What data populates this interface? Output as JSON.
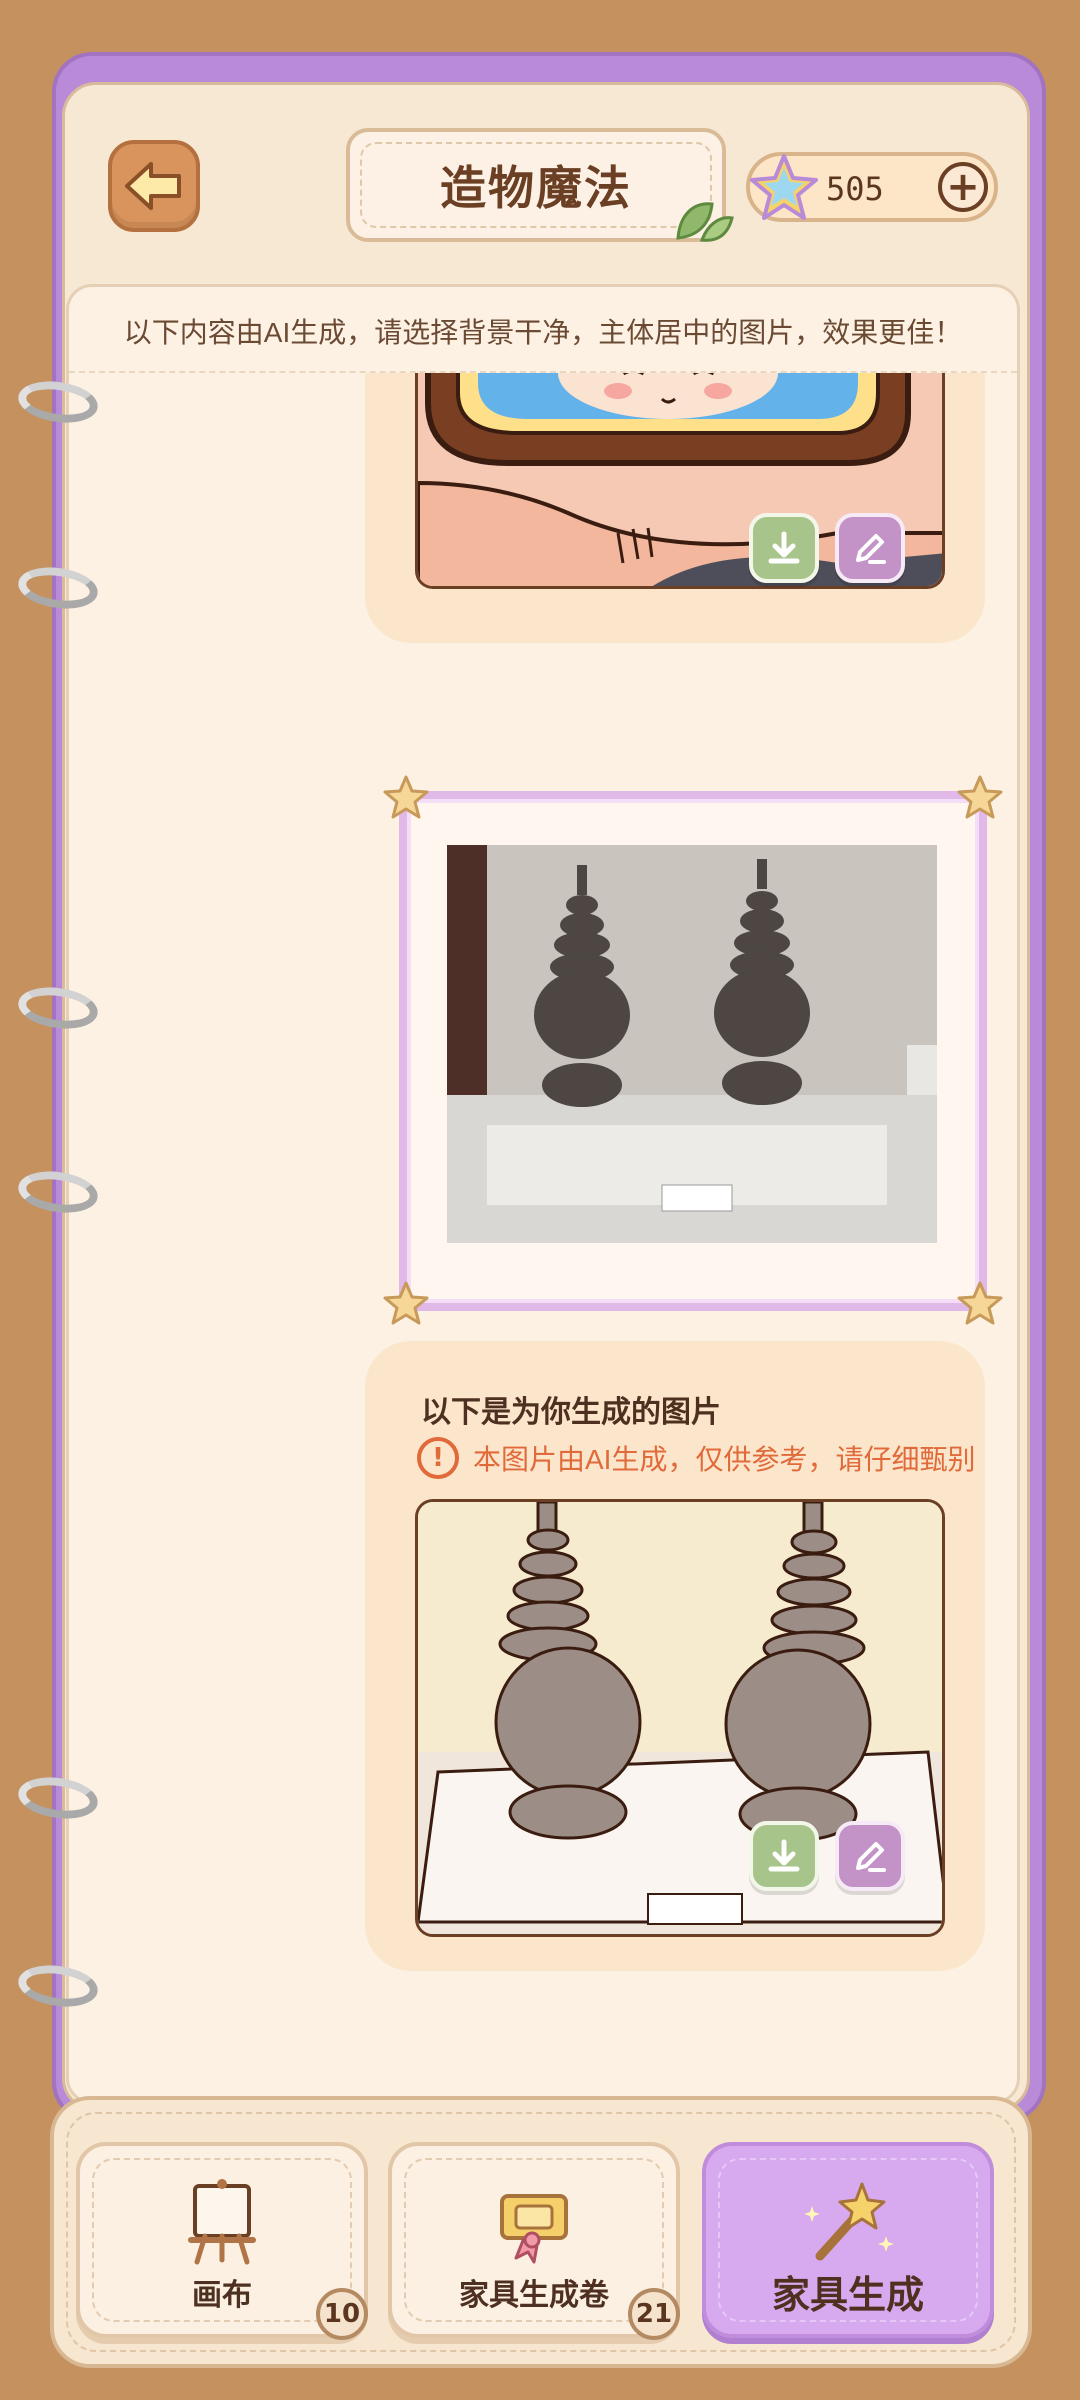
{
  "header": {
    "title": "造物魔法",
    "currency_value": "505",
    "back_icon": "back-arrow-icon",
    "plus_icon": "plus-icon"
  },
  "notice": "以下内容由AI生成，请选择背景干净，主体居中的图片，效果更佳！",
  "chat": {
    "reply": {
      "title": "以下是为你生成的图片",
      "warning": "本图片由AI生成，仅供参考，请仔细甄别"
    }
  },
  "tabs": [
    {
      "label": "画布",
      "badge": "10",
      "icon": "easel-icon",
      "active": false
    },
    {
      "label": "家具生成卷",
      "badge": "21",
      "icon": "scroll-ticket-icon",
      "active": false
    },
    {
      "label": "家具生成",
      "icon": "magic-wand-icon",
      "active": true
    }
  ],
  "colors": {
    "background": "#c4915f",
    "binder": "#b98ad8",
    "accent_text": "#6b3f24",
    "warning": "#e06a3a",
    "download_button": "#a7c48a",
    "edit_button": "#c392c7",
    "active_tab": "#d7a9ee"
  }
}
